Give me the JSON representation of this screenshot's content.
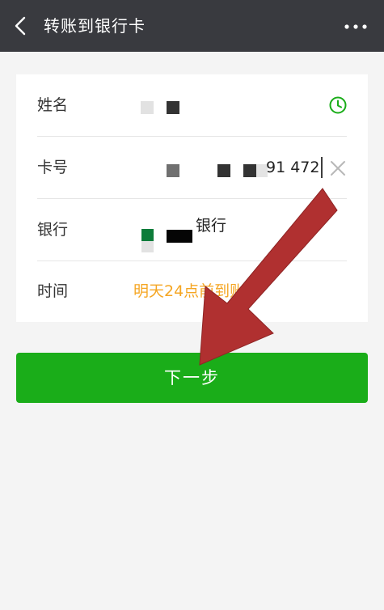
{
  "header": {
    "title": "转账到银行卡",
    "back_icon": "chevron-left-icon",
    "more_icon": "more-dots-icon"
  },
  "form": {
    "name": {
      "label": "姓名"
    },
    "card": {
      "label": "卡号",
      "partial_value": "91 472"
    },
    "bank": {
      "label": "银行",
      "partial_value": "银行"
    },
    "time": {
      "label": "时间",
      "value": "明天24点前到账"
    }
  },
  "next_button": {
    "label": "下一步"
  },
  "colors": {
    "header_bg": "#393a3f",
    "accent_green": "#1aad19",
    "time_orange": "#f5a623",
    "annotation_arrow": "#b03030"
  }
}
